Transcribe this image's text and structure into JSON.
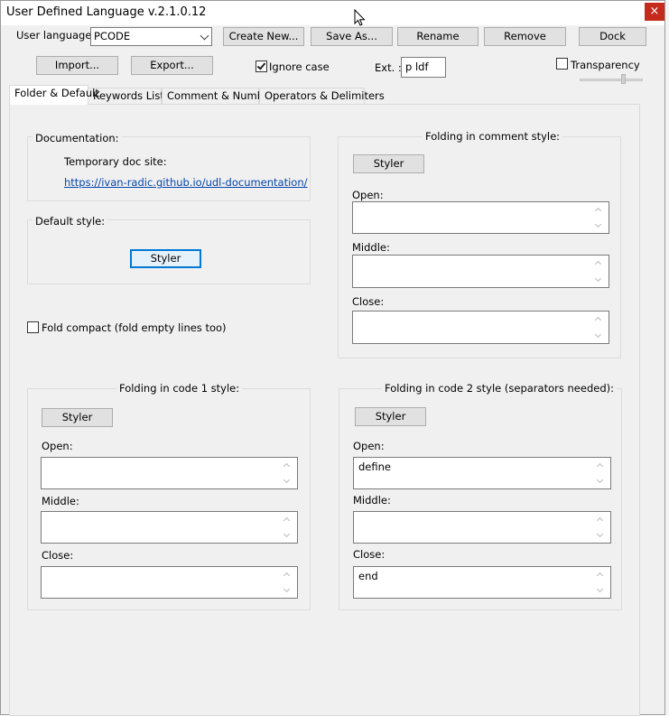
{
  "window": {
    "title": "User Defined Language v.2.1.0.12",
    "close_glyph": "×"
  },
  "toolbar": {
    "user_language_label": "User language :",
    "language_value": "PCODE",
    "create_new": "Create New...",
    "save_as": "Save As...",
    "rename": "Rename",
    "remove": "Remove",
    "dock": "Dock",
    "import": "Import...",
    "export": "Export...",
    "ignore_case": "Ignore case",
    "ignore_case_checked": true,
    "ext_label": "Ext. :",
    "ext_value": "p ldf",
    "transparency": "Transparency",
    "transparency_checked": false
  },
  "tabs": [
    {
      "label": "Folder & Default",
      "active": true
    },
    {
      "label": "Keywords Lists",
      "active": false
    },
    {
      "label": "Comment & Number",
      "active": false
    },
    {
      "label": "Operators & Delimiters",
      "active": false
    }
  ],
  "documentation": {
    "title": "Documentation:",
    "site_label": "Temporary doc site:",
    "link": "https://ivan-radic.github.io/udl-documentation/"
  },
  "default_style": {
    "title": "Default style:",
    "styler": "Styler"
  },
  "fold_compact": {
    "label": "Fold compact (fold empty lines too)",
    "checked": false
  },
  "comment_style": {
    "title": "Folding in comment style:",
    "styler": "Styler",
    "open_label": "Open:",
    "open_value": "",
    "middle_label": "Middle:",
    "middle_value": "",
    "close_label": "Close:",
    "close_value": ""
  },
  "code1_style": {
    "title": "Folding in code 1 style:",
    "styler": "Styler",
    "open_label": "Open:",
    "open_value": "",
    "middle_label": "Middle:",
    "middle_value": "",
    "close_label": "Close:",
    "close_value": ""
  },
  "code2_style": {
    "title": "Folding in code 2 style (separators needed):",
    "styler": "Styler",
    "open_label": "Open:",
    "open_value": "define",
    "middle_label": "Middle:",
    "middle_value": "",
    "close_label": "Close:",
    "close_value": "end"
  },
  "colors": {
    "accent": "#0078d7",
    "close": "#c42b1c",
    "link": "#0645ad"
  }
}
